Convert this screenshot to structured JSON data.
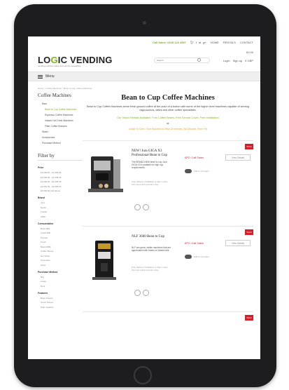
{
  "topbar": {
    "phone": "Call Sales: 0345 123 4567",
    "links": [
      "HOME",
      "RENTALS",
      "CONTACT"
    ],
    "social_icons": [
      "twitter-icon",
      "facebook-icon",
      "linkedin-icon",
      "google-plus-icon"
    ]
  },
  "header": {
    "logo_prefix": "LO",
    "logo_g": "G",
    "logo_suffix": "IC VENDING",
    "tagline": "vending machine sales and service specialists",
    "cart": "£0.00",
    "search_placeholder": "Search",
    "account_links": [
      "Login",
      "Sign up",
      "£ GBP"
    ]
  },
  "menu": {
    "label": "Menu"
  },
  "breadcrumb": "Home > Coffee Machines > Bean to Cup Coffee Machines",
  "sidebar": {
    "title": "Coffee Machines",
    "items": [
      {
        "label": "Bars",
        "sub": false,
        "active": false
      },
      {
        "label": "Bean to Cup Coffee Machines",
        "sub": true,
        "active": true
      },
      {
        "label": "Espresso Coffee Machines",
        "sub": true,
        "active": false
      },
      {
        "label": "Instant Hot Drink Machines",
        "sub": true,
        "active": false
      },
      {
        "label": "Filter Coffee Brewers",
        "sub": true,
        "active": false
      },
      {
        "label": "Water",
        "sub": false,
        "active": false
      },
      {
        "label": "Accessories",
        "sub": false,
        "active": false
      },
      {
        "label": "Purchase Method",
        "sub": false,
        "active": false
      }
    ],
    "filter_title": "Filter by",
    "filters": [
      {
        "group": "Price",
        "options": [
          "£1,000.00 - £1,999.99",
          "£2,000.00 - £2,999.99",
          "£3,000.00 - £3,999.99",
          "£4,000.00 - £4,999.99",
          "£5,000.00 and above"
        ]
      },
      {
        "group": "Brand",
        "options": [
          "Jura",
          "Necta",
          "Franke",
          "WMF"
        ]
      },
      {
        "group": "Consumables",
        "options": [
          "Bean Milk",
          "Liquid Milk",
          "Powder",
          "Fresh",
          "Beans/Milk",
          "Coffee Beans",
          "Hot Water",
          "Chocolate",
          "Other"
        ]
      },
      {
        "group": "Purchase Method",
        "options": [
          "Buy",
          "Lease",
          "Rent"
        ]
      },
      {
        "group": "Features",
        "options": [
          "Bean Hopper",
          "Touch Screen",
          "High Capacity"
        ]
      }
    ]
  },
  "main": {
    "title": "Bean to Cup Coffee Machines",
    "intro": "Bean to Cup Coffee Machines serve fresh ground coffee at the push of a button with some of the higher level machines capable of serving cappuccinos, lattes and other coffee specialities.",
    "promo": "Our Vision Rentals Available, Free Coffee Beans, Free Service Cover, Free Installation",
    "or": "or",
    "promo2": "Lease To Own: Your Machine At Risk Of Interest, No Deposit, Free Fix!"
  },
  "products": [
    {
      "badge": "SALE",
      "name": "NEW! Jura GIGA X3 Professional Bean to Cup",
      "desc": "The BRAND NEW bean to cup Jura GIGA X3 is suitable for high cup requirements.",
      "note": "Free delivery installation & train. Lease from just a few pounds a day.",
      "price": "£PO: Call Sales",
      "button": "View Details",
      "compare": "Add to Compare"
    },
    {
      "badge": "SALE",
      "name": "NLF 3600 Bean to Cup",
      "desc": "NLF are great, stable machines that are appreciated with beans or instant milk.",
      "note": "Free delivery installation & train. Lease from just a few pounds a day.",
      "price": "£PO: Call Sales",
      "button": "View Details",
      "compare": "Add to Compare"
    },
    {
      "badge": "SALE"
    }
  ],
  "colors": {
    "accent": "#7ab51d",
    "sale": "#d41f2b",
    "bezel": "#1d1d1f"
  }
}
